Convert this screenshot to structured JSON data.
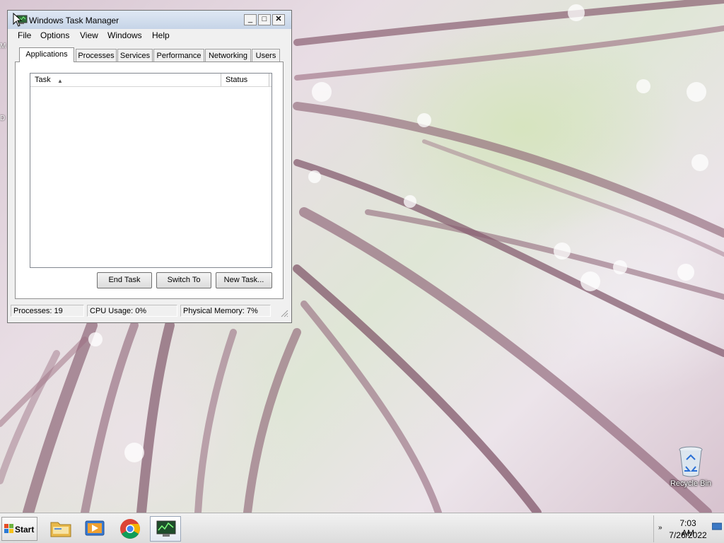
{
  "window": {
    "title": "Windows Task Manager",
    "controls": {
      "minimize": "_",
      "maximize": "□",
      "close": "✕"
    }
  },
  "menu": [
    "File",
    "Options",
    "View",
    "Windows",
    "Help"
  ],
  "tabs": [
    "Applications",
    "Processes",
    "Services",
    "Performance",
    "Networking",
    "Users"
  ],
  "active_tab": "Applications",
  "task_list": {
    "columns": [
      "Task",
      "Status"
    ],
    "sort_column": "Task",
    "sort_direction": "ascending",
    "rows": []
  },
  "buttons": {
    "end_task": "End Task",
    "switch_to": "Switch To",
    "new_task": "New Task..."
  },
  "status": {
    "processes": "Processes: 19",
    "cpu": "CPU Usage: 0%",
    "memory": "Physical Memory: 7%"
  },
  "desktop": {
    "icons": [
      {
        "label": "Recycle Bin",
        "icon": "recycle-bin-icon"
      }
    ],
    "side_glyphs": [
      "M",
      "D"
    ]
  },
  "taskbar": {
    "start_label": "Start",
    "pinned": [
      {
        "name": "windows-explorer",
        "icon": "folder-icon"
      },
      {
        "name": "media-player",
        "icon": "media-player-icon"
      },
      {
        "name": "chrome",
        "icon": "chrome-icon"
      },
      {
        "name": "task-manager",
        "icon": "task-manager-icon",
        "active": true
      }
    ],
    "clock": {
      "time": "7:03 AM",
      "date": "7/26/2022"
    },
    "tray_arrow": "»"
  }
}
